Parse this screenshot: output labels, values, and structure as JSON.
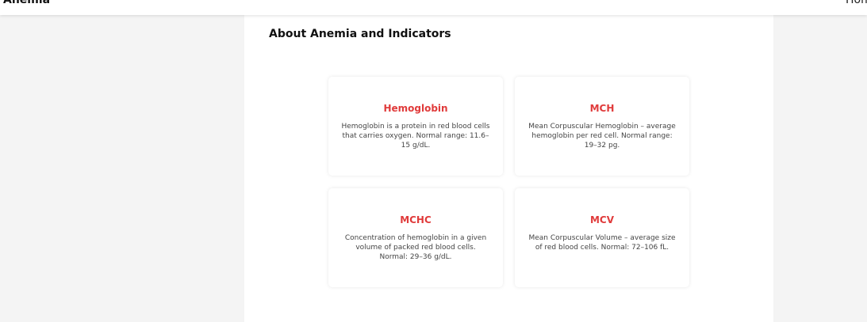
{
  "header": {
    "brand": "Anemia",
    "nav": {
      "home_label": "Home"
    }
  },
  "main": {
    "title": "About Anemia and Indicators",
    "cards": [
      {
        "title": "Hemoglobin",
        "text": "Hemoglobin is a protein in red blood cells that carries oxygen. Normal range: 11.6–15 g/dL."
      },
      {
        "title": "MCH",
        "text": "Mean Corpuscular Hemoglobin – average hemoglobin per red cell. Normal range: 19–32 pg."
      },
      {
        "title": "MCHC",
        "text": "Concentration of hemoglobin in a given volume of packed red blood cells. Normal: 29–36 g/dL."
      },
      {
        "title": "MCV",
        "text": "Mean Corpuscular Volume – average size of red blood cells. Normal: 72–106 fL."
      }
    ]
  },
  "colors": {
    "accent": "#e03b3b",
    "page_background": "#f4f4f4",
    "panel_background": "#ffffff"
  }
}
